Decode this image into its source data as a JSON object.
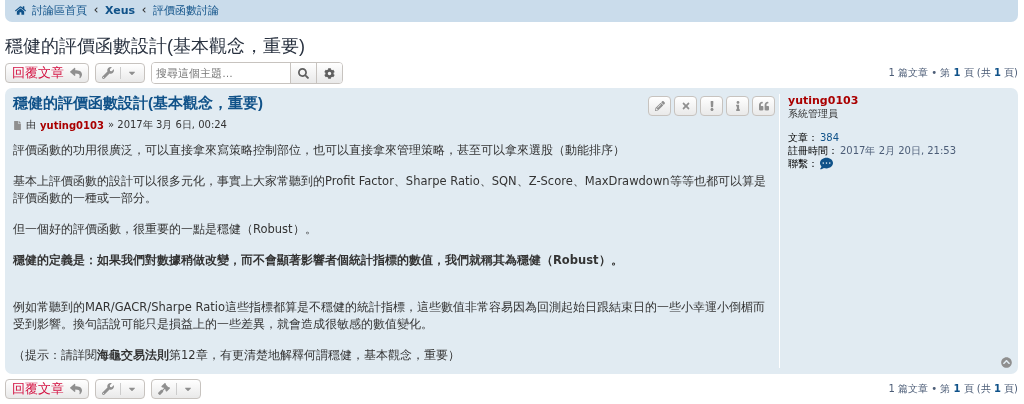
{
  "breadcrumbs": [
    {
      "label": "討論區首頁",
      "kind": "home"
    },
    {
      "label": "Xeus",
      "kind": "bold"
    },
    {
      "label": "評價函數討論",
      "kind": "plain"
    }
  ],
  "topic_title": "穩健的評價函數設計(基本觀念，重要)",
  "top_toolbar": {
    "reply": "回覆文章",
    "search": {
      "placeholder": "搜尋這個主題…"
    },
    "pagination": "1 篇文章 • 第 **1** 頁 (共 **1** 頁)"
  },
  "post": {
    "title": "穩健的評價函數設計(基本觀念，重要)",
    "by": "由",
    "author": "yuting0103",
    "date": "» 2017年 3月 6日, 00:24",
    "actions": [
      {
        "kind": "edit"
      },
      {
        "kind": "delete"
      },
      {
        "kind": "report"
      },
      {
        "kind": "info"
      },
      {
        "kind": "quote"
      }
    ],
    "paragraphs": [
      {
        "kind": "plain",
        "text": "評價函數的功用很廣泛，可以直接拿來寫策略控制部位，也可以直接拿來管理策略，甚至可以拿來選股（動能排序）"
      },
      {
        "kind": "plain",
        "text": "基本上評價函數的設計可以很多元化，事實上大家常聽到的Profit Factor、Sharpe Ratio、SQN、Z-Score、MaxDrawdown等等也都可以算是評價函數的一種或一部分。"
      },
      {
        "kind": "plain",
        "text": "但一個好的評價函數，很重要的一點是穩健（Robust）。"
      },
      {
        "kind": "bold",
        "text": "穩健的定義是：如果我們對數據稍做改變，而不會顯著影響者個統計指標的數值，我們就稱其為穩健（Robust）。"
      },
      {
        "kind": "plain",
        "text": "例如常聽到的MAR/GACR/Sharpe Ratio這些指標都算是不穩健的統計指標，這些數值非常容易因為回測起始日跟結束日的一些小幸運小倒楣而受到影響。換句話說可能只是損益上的一些差異，就會造成很敏感的數值變化。"
      },
      {
        "kind": "plain",
        "text": "（提示：請詳閱**海龜交易法則**第12章，有更清楚地解釋何謂穩健，基本觀念，重要）"
      }
    ],
    "profile": {
      "name": "yuting0103",
      "rank": "系統管理員",
      "fields": [
        {
          "label": "文章：",
          "value": "384",
          "kind": "link"
        },
        {
          "label": "註冊時間：",
          "value": "2017年 2月 20日, 21:53",
          "kind": "plain"
        },
        {
          "label": "聯繫：",
          "kind": "contact"
        }
      ]
    }
  },
  "bottom_toolbar": {
    "reply": "回覆文章",
    "pagination": "1 篇文章 • 第 **1** 頁 (共 **1** 頁)"
  }
}
